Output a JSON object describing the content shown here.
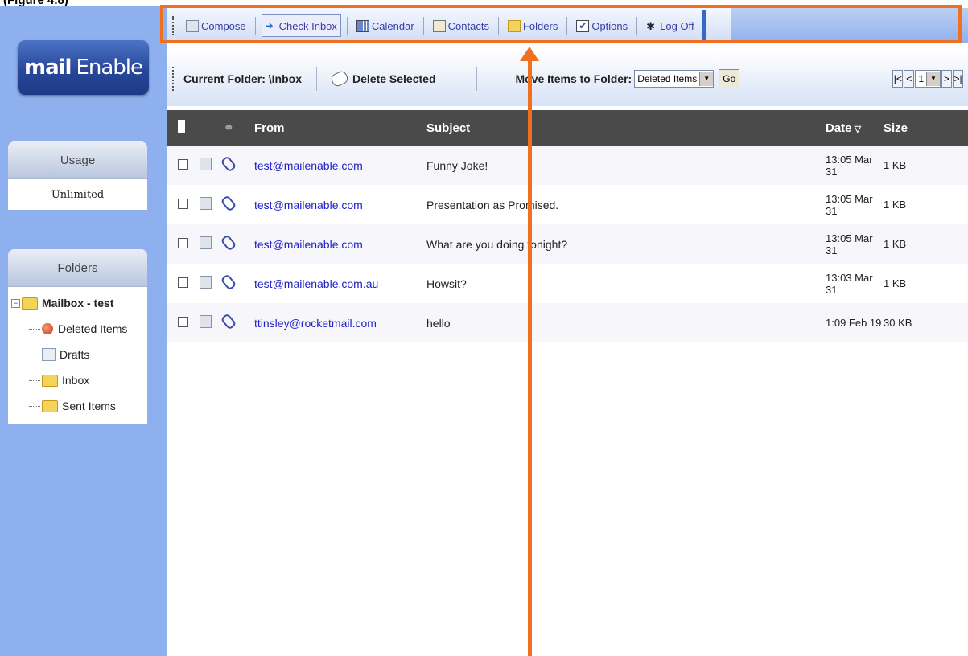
{
  "caption": "(Figure 4.8)",
  "logo": {
    "bold": "mail",
    "rest": "Enable"
  },
  "usage": {
    "title": "Usage",
    "value": "Unlimited"
  },
  "folders": {
    "title": "Folders",
    "root": "Mailbox - test",
    "items": [
      {
        "label": "Deleted Items",
        "icon": "deleted-items-icon"
      },
      {
        "label": "Drafts",
        "icon": "drafts-icon"
      },
      {
        "label": "Inbox",
        "icon": "folder-icon"
      },
      {
        "label": "Sent Items",
        "icon": "folder-icon"
      }
    ]
  },
  "toolbar": {
    "compose": "Compose",
    "check_inbox": "Check Inbox",
    "calendar": "Calendar",
    "contacts": "Contacts",
    "folders": "Folders",
    "options": "Options",
    "log_off": "Log Off"
  },
  "folder_bar": {
    "current_folder": "Current Folder: \\Inbox",
    "delete_selected": "Delete Selected",
    "move_label": "Move Items to Folder:",
    "move_selected": "Deleted Items",
    "go": "Go",
    "page": "1"
  },
  "columns": {
    "from": "From",
    "subject": "Subject",
    "date": "Date",
    "size": "Size"
  },
  "messages": [
    {
      "from": "test@mailenable.com",
      "subject": "Funny Joke!",
      "date": "13:05 Mar 31",
      "size": "1 KB"
    },
    {
      "from": "test@mailenable.com",
      "subject": "Presentation as Promised.",
      "date": "13:05 Mar 31",
      "size": "1 KB"
    },
    {
      "from": "test@mailenable.com",
      "subject": "What are you doing tonight?",
      "date": "13:05 Mar 31",
      "size": "1 KB"
    },
    {
      "from": "test@mailenable.com.au",
      "subject": "Howsit?",
      "date": "13:03 Mar 31",
      "size": "1 KB"
    },
    {
      "from": "ttinsley@rocketmail.com",
      "subject": "hello",
      "date": "1:09 Feb 19",
      "size": "30 KB"
    }
  ],
  "colors": {
    "highlight": "#f07020",
    "sidebar": "#8fb0ee",
    "header": "#4a4a4a"
  }
}
